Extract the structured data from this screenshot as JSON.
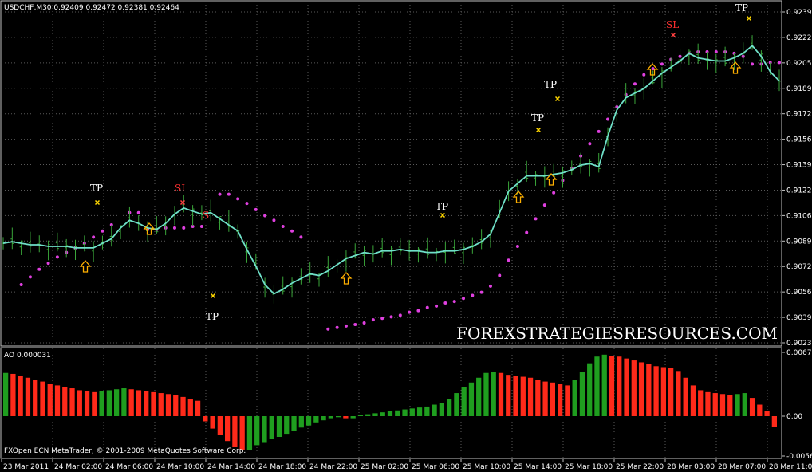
{
  "header": {
    "symbol_info": "USDCHF,M30  0.92409 0.92472 0.92381 0.92464",
    "ao_label": "AO 0.000031",
    "footer": "FXOpen ECN MetaTrader, © 2001-2009 MetaQuotes Software Corp.",
    "watermark": "FOREXSTRATEGIESRESOURCES.COM"
  },
  "colors": {
    "background": "#000000",
    "frame": "#c0c0c0",
    "grid": "#5a5a5a",
    "candles": "#3aa63a",
    "ma_line": "#6fe0c8",
    "sar_dots": "#e040e0",
    "ao_up": "#1f9e1f",
    "ao_down": "#ff2a1a",
    "arrows": "#ffb000",
    "marker_tp": "#ffd700",
    "marker_sl": "#ff4040"
  },
  "price_axis": {
    "ticks": [
      "0.92390",
      "0.92225",
      "0.92055",
      "0.91890",
      "0.91725",
      "0.91560",
      "0.91390",
      "0.91225",
      "0.91060",
      "0.90890",
      "0.90725",
      "0.90560",
      "0.90390",
      "0.90230"
    ]
  },
  "ao_axis": {
    "ticks": [
      "0.00676",
      "0.00",
      "-0.00565"
    ]
  },
  "time_axis": {
    "labels": [
      "23 Mar 2011",
      "24 Mar 02:00",
      "24 Mar 06:00",
      "24 Mar 10:00",
      "24 Mar 14:00",
      "24 Mar 18:00",
      "24 Mar 22:00",
      "25 Mar 02:00",
      "25 Mar 06:00",
      "25 Mar 10:00",
      "25 Mar 14:00",
      "25 Mar 18:00",
      "25 Mar 22:00",
      "28 Mar 03:00",
      "28 Mar 07:00",
      "28 Mar 11:00"
    ]
  },
  "annotations": {
    "tp": "TP",
    "sl": "SL",
    "sl_short": "S"
  },
  "chart_data": {
    "type": "line",
    "price_series": [
      0.9088,
      0.9089,
      0.9088,
      0.9087,
      0.9087,
      0.9086,
      0.9086,
      0.9086,
      0.9085,
      0.9085,
      0.9085,
      0.9088,
      0.9091,
      0.9098,
      0.9103,
      0.9101,
      0.9098,
      0.9097,
      0.9101,
      0.9107,
      0.9111,
      0.9109,
      0.9107,
      0.9108,
      0.9104,
      0.91,
      0.9096,
      0.9084,
      0.9073,
      0.9061,
      0.9055,
      0.9058,
      0.9062,
      0.9065,
      0.9068,
      0.9067,
      0.907,
      0.9074,
      0.9078,
      0.908,
      0.9082,
      0.9081,
      0.9083,
      0.9083,
      0.9084,
      0.9083,
      0.9083,
      0.9082,
      0.9082,
      0.9083,
      0.9083,
      0.9084,
      0.9086,
      0.9089,
      0.9094,
      0.9108,
      0.9122,
      0.9127,
      0.9132,
      0.9132,
      0.9132,
      0.9133,
      0.9134,
      0.9136,
      0.9139,
      0.914,
      0.9138,
      0.9158,
      0.9175,
      0.9183,
      0.9186,
      0.9189,
      0.9194,
      0.9199,
      0.9203,
      0.9207,
      0.9212,
      0.9209,
      0.9208,
      0.9207,
      0.9207,
      0.9209,
      0.9212,
      0.9217,
      0.921,
      0.92,
      0.9194
    ],
    "sar_series": [
      null,
      null,
      0.9061,
      0.9066,
      0.9071,
      0.9075,
      0.9079,
      0.9082,
      0.9085,
      0.9088,
      0.9092,
      0.9096,
      0.91,
      null,
      0.9108,
      0.9108,
      0.9097,
      0.9097,
      0.9098,
      0.9098,
      0.9098,
      0.9099,
      0.9099,
      null,
      0.912,
      0.912,
      0.9117,
      0.9114,
      0.911,
      0.9106,
      0.9103,
      0.9099,
      0.9096,
      0.9092,
      null,
      null,
      0.9032,
      0.9033,
      0.9034,
      0.9035,
      0.9036,
      0.9038,
      0.9039,
      0.904,
      0.9041,
      0.9043,
      0.9044,
      0.9046,
      0.9047,
      0.9049,
      0.905,
      0.9052,
      0.9054,
      0.9056,
      0.906,
      0.9067,
      0.9077,
      0.9086,
      0.9095,
      0.9104,
      0.9113,
      0.9121,
      0.9129,
      0.9137,
      0.9145,
      0.9153,
      0.9161,
      0.9169,
      0.9177,
      0.9185,
      0.9192,
      0.9198,
      0.9202,
      0.9205,
      0.9208,
      0.921,
      0.9212,
      0.9213,
      0.9213,
      0.9213,
      0.9213,
      0.9212,
      0.921,
      0.9205,
      0.9205,
      0.9206,
      0.9206
    ],
    "ao_series": [
      0.0045,
      0.0044,
      0.0042,
      0.004,
      0.0038,
      0.0036,
      0.0034,
      0.0032,
      0.003,
      0.0029,
      0.0027,
      0.0026,
      0.0025,
      0.0026,
      0.0027,
      0.0028,
      0.0029,
      0.0028,
      0.0027,
      0.0026,
      0.0025,
      0.0024,
      0.0023,
      0.0022,
      0.002,
      0.0018,
      0.0016,
      -0.0005,
      -0.0012,
      -0.0018,
      -0.0024,
      -0.003,
      -0.0033,
      -0.0033,
      -0.0028,
      -0.0025,
      -0.0022,
      -0.002,
      -0.0017,
      -0.0014,
      -0.0011,
      -0.0009,
      -0.0006,
      -0.0004,
      -0.0002,
      -0.0001,
      -0.0002,
      -0.0002,
      0.0001,
      0.0002,
      0.0003,
      0.0004,
      0.0005,
      0.0006,
      0.0007,
      0.0008,
      0.0009,
      0.001,
      0.0012,
      0.0014,
      0.0018,
      0.0024,
      0.003,
      0.0035,
      0.004,
      0.0045,
      0.0046,
      0.0045,
      0.0043,
      0.0042,
      0.0041,
      0.004,
      0.0038,
      0.0036,
      0.0035,
      0.0034,
      0.0032,
      0.0038,
      0.0046,
      0.0055,
      0.0062,
      0.0064,
      0.0063,
      0.0062,
      0.006,
      0.0058,
      0.0056,
      0.0054,
      0.0052,
      0.0051,
      0.005,
      0.0047,
      0.004,
      0.0032,
      0.0027,
      0.0025,
      0.0024,
      0.0023,
      0.0022,
      0.0023,
      0.0024,
      0.0019,
      0.0012,
      0.0005,
      -0.001
    ],
    "ylim": [
      0.9023,
      0.9239
    ],
    "ao_ylim": [
      -0.004,
      0.0068
    ]
  }
}
